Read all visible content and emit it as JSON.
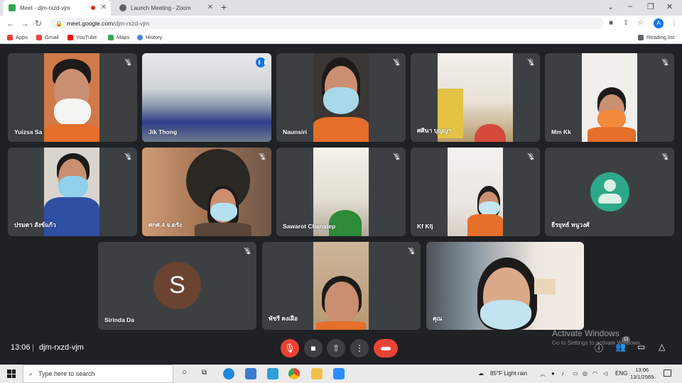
{
  "browser": {
    "tabs": [
      {
        "title": "Meet - djm-rxzd-vjm",
        "active": true,
        "recording": true
      },
      {
        "title": "Launch Meeting - Zoom",
        "active": false
      }
    ],
    "url_host": "meet.google.com",
    "url_path": "/djm-rxzd-vjm",
    "profile_initial": "A",
    "bookmarks": [
      "Apps",
      "Gmail",
      "YouTube",
      "Maps",
      "History"
    ],
    "reading_list": "Reading list"
  },
  "participants": [
    {
      "name": "Yuizsa Sa"
    },
    {
      "name": "Jik Thong"
    },
    {
      "name": "Naunsiri"
    },
    {
      "name": "ศศินา บุญญา"
    },
    {
      "name": "Mm Kk"
    },
    {
      "name": "ปรมดา สังข์แก้ว"
    },
    {
      "name": "ศกศ.4 จ.ตรัง"
    },
    {
      "name": "Sawarot Chanatep"
    },
    {
      "name": "Kf Kfj"
    },
    {
      "name": "ธีรยุทธ์ หนูวงศ์"
    },
    {
      "name": "Sirinda Da",
      "avatar_letter": "S"
    },
    {
      "name": "พัชรี คงเฝือ"
    },
    {
      "name": "คุณ"
    }
  ],
  "meeting": {
    "time": "13:06",
    "separator": "|",
    "code": "djm-rxzd-vjm",
    "people_count": "13"
  },
  "watermark": {
    "title": "Activate Windows",
    "subtitle": "Go to Settings to activate Windows."
  },
  "taskbar": {
    "search_placeholder": "Type here to search",
    "weather": "85°F  Light rain",
    "language": "ENG",
    "time": "13:06",
    "date": "13/1/2565"
  },
  "colors": {
    "meet_bg": "#202124",
    "tile_bg": "#3c4043",
    "end_call_red": "#ea4335",
    "speaking_blue": "#1a73e8",
    "avatar_teal": "#2ea88a",
    "avatar_brown": "#6b4332"
  }
}
